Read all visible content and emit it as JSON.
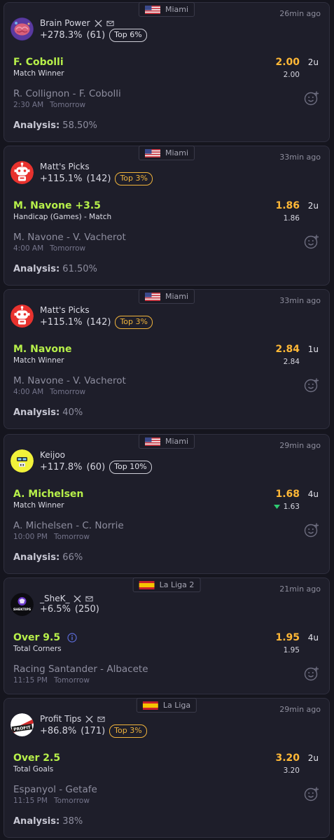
{
  "colors": {
    "background": "#15151e",
    "card": "#1e1e2a",
    "pick_green": "#b7f04a",
    "odds_orange": "#ffb836",
    "top_badge_gold": "#f0b43c",
    "drop_arrow": "#2ecc71"
  },
  "cards": [
    {
      "league": {
        "flag": "usa-flag",
        "name": "Miami"
      },
      "time_ago": "26min ago",
      "tipster": {
        "name": "Brain Power",
        "avatar": "brain-avatar",
        "has_x": true,
        "has_email": true,
        "profit": "+278.3%",
        "count": "(61)",
        "badge": "Top 6%",
        "badge_style": "white"
      },
      "pick": "F. Cobolli",
      "market": "Match Winner",
      "odds": "2.00",
      "odds_current": "2.00",
      "odds_dropped": false,
      "units": "2u",
      "match": "R. Collignon - F. Cobolli",
      "time": "2:30 AM",
      "day": "Tomorrow",
      "analysis_label": "Analysis:",
      "analysis_value": "58.50%"
    },
    {
      "league": {
        "flag": "usa-flag",
        "name": "Miami"
      },
      "time_ago": "33min ago",
      "tipster": {
        "name": "Matt's Picks",
        "avatar": "robot-avatar",
        "has_x": false,
        "has_email": false,
        "profit": "+115.1%",
        "count": "(142)",
        "badge": "Top 3%",
        "badge_style": "gold"
      },
      "pick": "M. Navone +3.5",
      "market": "Handicap (Games) - Match",
      "odds": "1.86",
      "odds_current": "1.86",
      "odds_dropped": false,
      "units": "2u",
      "match": "M. Navone - V. Vacherot",
      "time": "4:00 AM",
      "day": "Tomorrow",
      "analysis_label": "Analysis:",
      "analysis_value": "61.50%"
    },
    {
      "league": {
        "flag": "usa-flag",
        "name": "Miami"
      },
      "time_ago": "33min ago",
      "tipster": {
        "name": "Matt's Picks",
        "avatar": "robot-avatar",
        "has_x": false,
        "has_email": false,
        "profit": "+115.1%",
        "count": "(142)",
        "badge": "Top 3%",
        "badge_style": "gold"
      },
      "pick": "M. Navone",
      "market": "Match Winner",
      "odds": "2.84",
      "odds_current": "2.84",
      "odds_dropped": false,
      "units": "1u",
      "match": "M. Navone - V. Vacherot",
      "time": "4:00 AM",
      "day": "Tomorrow",
      "analysis_label": "Analysis:",
      "analysis_value": "40%"
    },
    {
      "league": {
        "flag": "usa-flag",
        "name": "Miami"
      },
      "time_ago": "29min ago",
      "tipster": {
        "name": "Keijoo",
        "avatar": "keijoo-avatar",
        "has_x": false,
        "has_email": false,
        "profit": "+117.8%",
        "count": "(60)",
        "badge": "Top 10%",
        "badge_style": "white"
      },
      "pick": "A. Michelsen",
      "market": "Match Winner",
      "odds": "1.68",
      "odds_current": "1.63",
      "odds_dropped": true,
      "units": "4u",
      "match": "A. Michelsen - C. Norrie",
      "time": "10:00 PM",
      "day": "Tomorrow",
      "analysis_label": "Analysis:",
      "analysis_value": "66%"
    },
    {
      "league": {
        "flag": "spain-flag",
        "name": "La Liga 2"
      },
      "time_ago": "21min ago",
      "tipster": {
        "name": "_SheK_",
        "avatar": "shektips-avatar",
        "avatar_text": "SHEKTIPS",
        "has_x": true,
        "has_email": true,
        "profit": "+6.5%",
        "count": "(250)",
        "badge": "",
        "badge_style": "none"
      },
      "pick": "Over 9.5",
      "market": "Total Corners",
      "has_info": true,
      "odds": "1.95",
      "odds_current": "1.95",
      "odds_dropped": false,
      "units": "4u",
      "match": "Racing Santander - Albacete",
      "time": "11:15 PM",
      "day": "Tomorrow",
      "analysis_label": "",
      "analysis_value": ""
    },
    {
      "league": {
        "flag": "spain-flag",
        "name": "La Liga"
      },
      "time_ago": "29min ago",
      "tipster": {
        "name": "Profit Tips",
        "avatar": "profit-avatar",
        "avatar_text": "PROFIT",
        "has_x": true,
        "has_email": true,
        "profit": "+86.8%",
        "count": "(171)",
        "badge": "Top 3%",
        "badge_style": "gold"
      },
      "pick": "Over 2.5",
      "market": "Total Goals",
      "odds": "3.20",
      "odds_current": "3.20",
      "odds_dropped": false,
      "units": "2u",
      "match": "Espanyol - Getafe",
      "time": "11:15 PM",
      "day": "Tomorrow",
      "analysis_label": "Analysis:",
      "analysis_value": "38%"
    }
  ]
}
